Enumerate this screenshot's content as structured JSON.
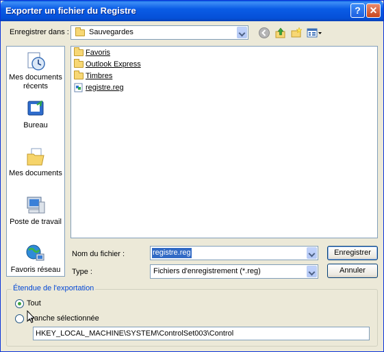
{
  "window": {
    "title": "Exporter un fichier du Registre"
  },
  "titlebar": {
    "help_glyph": "?",
    "close_glyph": "✕"
  },
  "toolbar": {
    "save_in_label": "Enregistrer dans :",
    "save_in_value": "Sauvegardes",
    "icons": [
      "back-icon",
      "up-folder-icon",
      "new-folder-icon",
      "view-menu-icon"
    ]
  },
  "places": [
    {
      "label": "Mes documents récents",
      "icon": "recent-documents-icon"
    },
    {
      "label": "Bureau",
      "icon": "desktop-icon"
    },
    {
      "label": "Mes documents",
      "icon": "my-documents-icon"
    },
    {
      "label": "Poste de travail",
      "icon": "my-computer-icon"
    },
    {
      "label": "Favoris réseau",
      "icon": "network-places-icon"
    }
  ],
  "files": [
    {
      "name": "Favoris",
      "type": "folder"
    },
    {
      "name": "Outlook Express",
      "type": "folder"
    },
    {
      "name": "Timbres",
      "type": "folder"
    },
    {
      "name": "registre.reg",
      "type": "reg-file"
    }
  ],
  "form": {
    "filename_label": "Nom du fichier :",
    "filename_value": "registre.reg",
    "type_label": "Type :",
    "type_value": "Fichiers d'enregistrement (*.reg)",
    "save_button": "Enregistrer",
    "cancel_button": "Annuler"
  },
  "export_range": {
    "title": "Étendue de l'exportation",
    "all_label": "Tout",
    "all_selected": true,
    "branch_label": "Branche sélectionnée",
    "branch_value": "HKEY_LOCAL_MACHINE\\SYSTEM\\ControlSet003\\Control"
  }
}
